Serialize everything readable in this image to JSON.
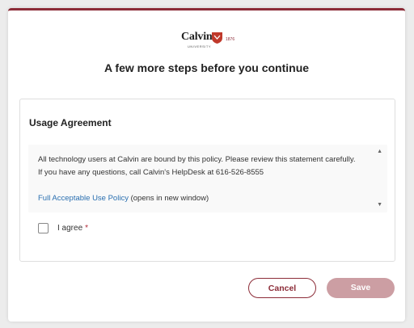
{
  "logo": {
    "name": "Calvin",
    "subtitle": "UNIVERSITY",
    "year": "1876",
    "brand_color": "#8c2c38"
  },
  "heading": "A few more steps before you continue",
  "agreement": {
    "title": "Usage Agreement",
    "text": "All technology users at Calvin are bound by this policy.  Please review this statement carefully.  If you have any questions, call Calvin's HelpDesk at 616-526-8555",
    "link_text": "Full Acceptable Use Policy",
    "link_note": " (opens in new window)",
    "scroll_up_icon": "scroll-up-arrow",
    "scroll_down_icon": "scroll-down-arrow"
  },
  "checkbox": {
    "label": "I agree",
    "required_marker": "*",
    "checked": false
  },
  "buttons": {
    "cancel": "Cancel",
    "save": "Save"
  },
  "colors": {
    "accent": "#8c2c38",
    "save_disabled": "#cc9ea3",
    "link": "#2a6fb0"
  }
}
